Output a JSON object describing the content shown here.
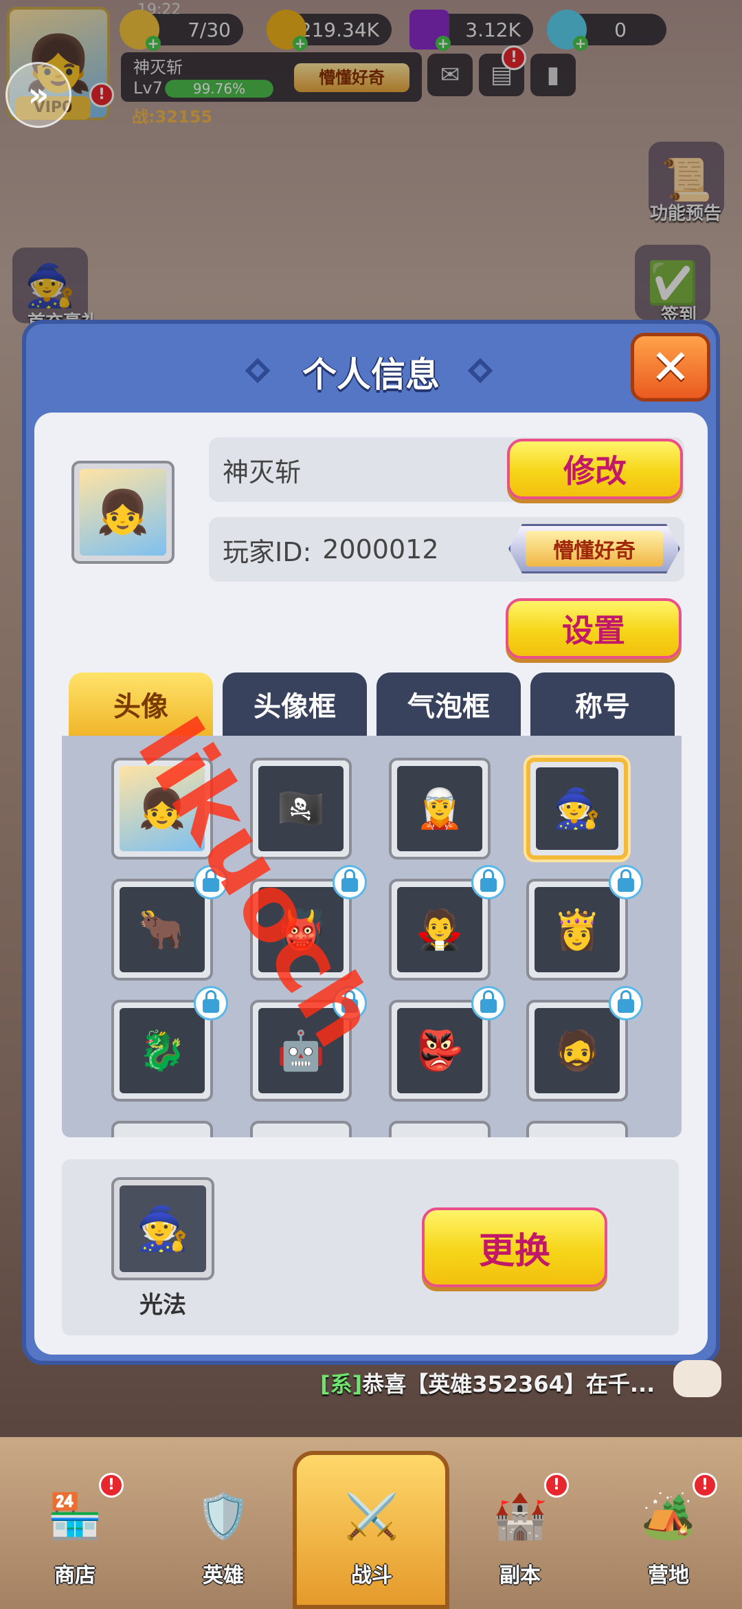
{
  "hud": {
    "time": "19:22",
    "stamina": "7/30",
    "gold": "219.34K",
    "gems": "3.12K",
    "diamonds": "0",
    "player_name": "神灭斩",
    "level": "Lv7",
    "exp_percent": "99.76%",
    "exp_fraction": 0.9976,
    "title": "懵懂好奇",
    "power": "战:32155",
    "vip": "VIP0"
  },
  "side": {
    "preview_label": "功能预告",
    "checkin_label": "签到",
    "first_recharge_label": "首充豪礼"
  },
  "modal": {
    "title": "个人信息",
    "player_name": "神灭斩",
    "modify_label": "修改",
    "player_id_label": "玩家ID:",
    "player_id": "2000012",
    "title_tag": "懵懂好奇",
    "settings_label": "设置",
    "tabs": [
      "头像",
      "头像框",
      "气泡框",
      "称号"
    ],
    "active_tab": 0,
    "avatars": [
      {
        "icon": "blonde-girl",
        "locked": false,
        "selected": false,
        "emoji": "👧"
      },
      {
        "icon": "pirate-captain",
        "locked": false,
        "selected": false,
        "emoji": "🏴‍☠️"
      },
      {
        "icon": "purple-elf",
        "locked": false,
        "selected": false,
        "emoji": "🧝"
      },
      {
        "icon": "white-paladin",
        "locked": false,
        "selected": true,
        "emoji": "🧙"
      },
      {
        "icon": "minotaur",
        "locked": true,
        "selected": false,
        "emoji": "🐂"
      },
      {
        "icon": "grey-orc",
        "locked": true,
        "selected": false,
        "emoji": "👹"
      },
      {
        "icon": "dark-elf",
        "locked": true,
        "selected": false,
        "emoji": "🧛"
      },
      {
        "icon": "fire-princess",
        "locked": true,
        "selected": false,
        "emoji": "👸"
      },
      {
        "icon": "blue-dragon",
        "locked": true,
        "selected": false,
        "emoji": "🐉"
      },
      {
        "icon": "red-golem",
        "locked": true,
        "selected": false,
        "emoji": "🤖"
      },
      {
        "icon": "purple-goblin",
        "locked": true,
        "selected": false,
        "emoji": "👺"
      },
      {
        "icon": "dwarf-mage",
        "locked": true,
        "selected": false,
        "emoji": "🧔"
      }
    ],
    "preview_name": "光法",
    "change_label": "更换"
  },
  "chat": {
    "tag": "[系]",
    "text": "恭喜【英雄352364】在千..."
  },
  "nav": [
    {
      "label": "商店",
      "icon": "shop-icon",
      "emoji": "🏪",
      "alert": true
    },
    {
      "label": "英雄",
      "icon": "hero-icon",
      "emoji": "🛡️",
      "alert": false
    },
    {
      "label": "战斗",
      "icon": "battle-icon",
      "emoji": "⚔️",
      "alert": false
    },
    {
      "label": "副本",
      "icon": "dungeon-icon",
      "emoji": "🏰",
      "alert": true
    },
    {
      "label": "营地",
      "icon": "camp-icon",
      "emoji": "🏕️",
      "alert": true
    }
  ],
  "watermark": "likuoch",
  "colors": {
    "modal_blue": "#5576c5",
    "button_yellow": "#f6d518",
    "button_text": "#c2186a",
    "close_orange": "#ea5a1f",
    "tab_active": "#f0b62a",
    "tab_inactive": "#39425d"
  }
}
